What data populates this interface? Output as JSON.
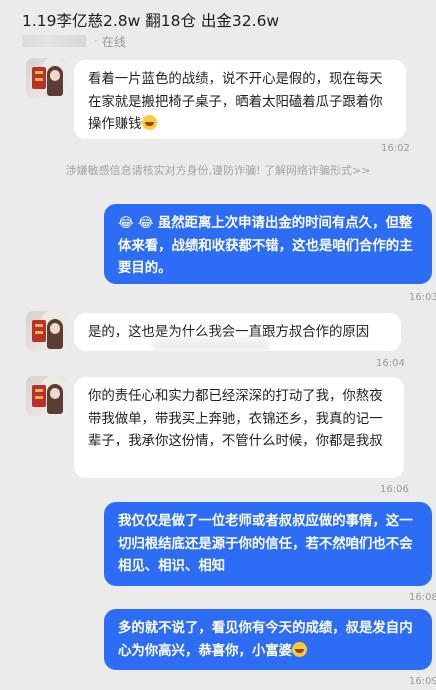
{
  "header": {
    "title": "1.19李亿慈2.8w 翻18仓 出金32.6w",
    "status_sep": "·",
    "status": "在线"
  },
  "messages": [
    {
      "dir": "in",
      "text": "看着一片蓝色的战绩，说不开心是假的，现在每天在家就是搬把椅子桌子，晒着太阳磕着瓜子跟着你操作赚钱",
      "emoji": "grinning-face",
      "time": "16:02"
    },
    {
      "dir": "out",
      "emoji_lead": "😂 😂",
      "text": "虽然距离上次申请出金的时间有点久，但整体来看，战绩和收获都不错，这也是咱们合作的主要目的。",
      "time": "16:03"
    },
    {
      "dir": "in",
      "text": "是的，这也是为什么我会一直跟方叔合作的原因",
      "time": "16:04"
    },
    {
      "dir": "in",
      "text": "你的责任心和实力都已经深深的打动了我，你熬夜带我做单，带我买上奔驰，衣锦还乡，我真的记一辈子，我承你这份情，不管什么时候，你都是我叔",
      "time": "16:06"
    },
    {
      "dir": "out",
      "text": "我仅仅是做了一位老师或者叔叔应做的事情，这一切归根结底还是源于你的信任，若不然咱们也不会相见、相识、相知",
      "time": "16:08"
    },
    {
      "dir": "out",
      "text": "多的就不说了，看见你有今天的成绩，叔是发自内心为你高兴，恭喜你，小富婆",
      "emoji": "smiling-face",
      "time": "16:09"
    }
  ],
  "notice": {
    "text": "涉嫌敏感信息请核实对方身份,谨防诈骗! ",
    "link": "了解网络诈骗形式>>"
  }
}
